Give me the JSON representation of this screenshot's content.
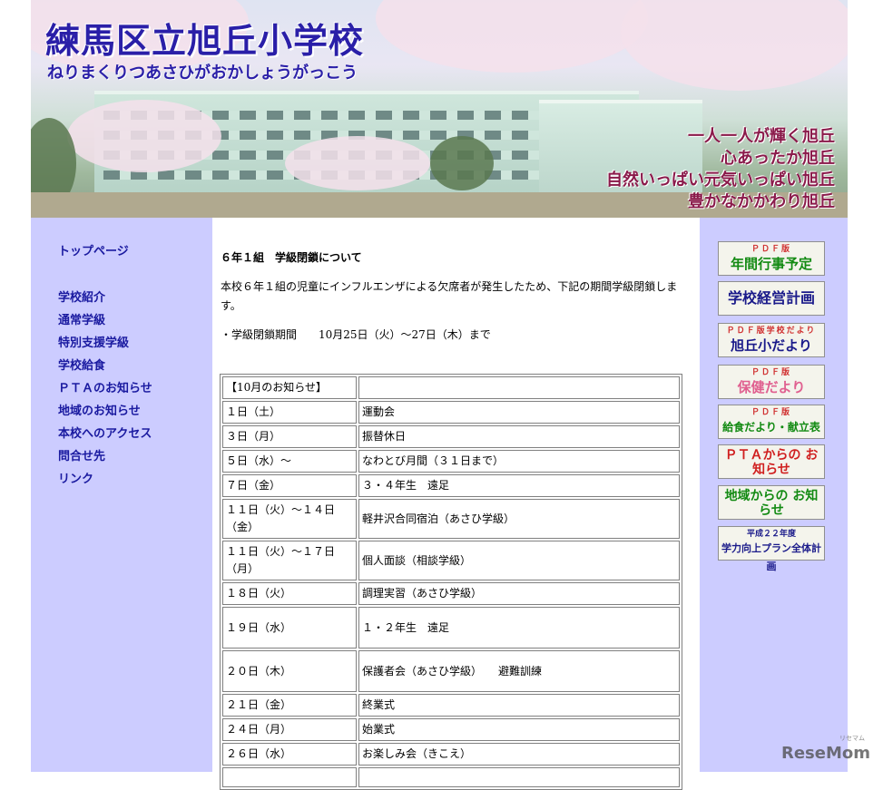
{
  "header": {
    "school_name": "練馬区立旭丘小学校",
    "school_kana": "ねりまくりつあさひがおかしょうがっこう",
    "mottos": [
      "一人一人が輝く旭丘",
      "心あったか旭丘",
      "自然いっぱい元気いっぱい旭丘",
      "豊かなかかわり旭丘"
    ]
  },
  "left_nav": {
    "top_page": "トップページ",
    "items": [
      "学校紹介",
      "通常学級",
      "特別支援学級",
      "学校給食",
      "ＰＴＡのお知らせ",
      "地域のお知らせ",
      "本校へのアクセス",
      "問合せ先",
      "リンク"
    ]
  },
  "notice": {
    "title": "６年１組　学級閉鎖について",
    "body": "本校６年１組の児童にインフルエンザによる欠席者が発生したため、下記の期間学級閉鎖します。",
    "period": "・学級閉鎖期間　　10月25日（火）～27日（木）まで"
  },
  "events": {
    "header": "【10月のお知らせ】",
    "rows": [
      {
        "date": "１日（土）",
        "event": "運動会"
      },
      {
        "date": "３日（月）",
        "event": "振替休日"
      },
      {
        "date": "５日（水）～",
        "event": "なわとび月間（３１日まで）"
      },
      {
        "date": "７日（金）",
        "event": "３・４年生　遠足"
      },
      {
        "date": "１１日（火）～１４日（金）",
        "event": "軽井沢合同宿泊（あさひ学級）"
      },
      {
        "date": "１１日（火）～１７日（月）",
        "event": "個人面談（相談学級）"
      },
      {
        "date": "１８日（火）",
        "event": "調理実習（あさひ学級）"
      },
      {
        "date": "１９日（水）",
        "event": "１・２年生　遠足"
      },
      {
        "date": "２０日（木）",
        "event": "保護者会（あさひ学級）　　避難訓練"
      },
      {
        "date": "２１日（金）",
        "event": "終業式"
      },
      {
        "date": "２４日（月）",
        "event": "始業式"
      },
      {
        "date": "２６日（水）",
        "event": "お楽しみ会（きこえ）"
      }
    ]
  },
  "right_banners": [
    {
      "small": "ＰＤＦ版",
      "big": "年間行事予定",
      "color": "#128a12"
    },
    {
      "small": "",
      "big": "学校経営計画",
      "color": "#1a1a8a"
    },
    {
      "small": "ＰＤＦ版学校だより",
      "big": "旭丘小だより",
      "color": "#1a1a8a"
    },
    {
      "small": "ＰＤＦ版",
      "big": "保健だより",
      "color": "#e06090"
    },
    {
      "small": "ＰＤＦ版",
      "big": "給食だより・献立表",
      "color": "#128a12"
    },
    {
      "small": "",
      "big": "ＰＴＡからの お知らせ",
      "color": "#d02020"
    },
    {
      "small": "",
      "big": "地域からの お知らせ",
      "color": "#128a12"
    },
    {
      "small": "平成２２年度",
      "big": "学力向上プラン全体計画",
      "color": "#1a1a8a"
    }
  ],
  "watermark": {
    "text": "ReseMom",
    "sub": "リセマム"
  }
}
